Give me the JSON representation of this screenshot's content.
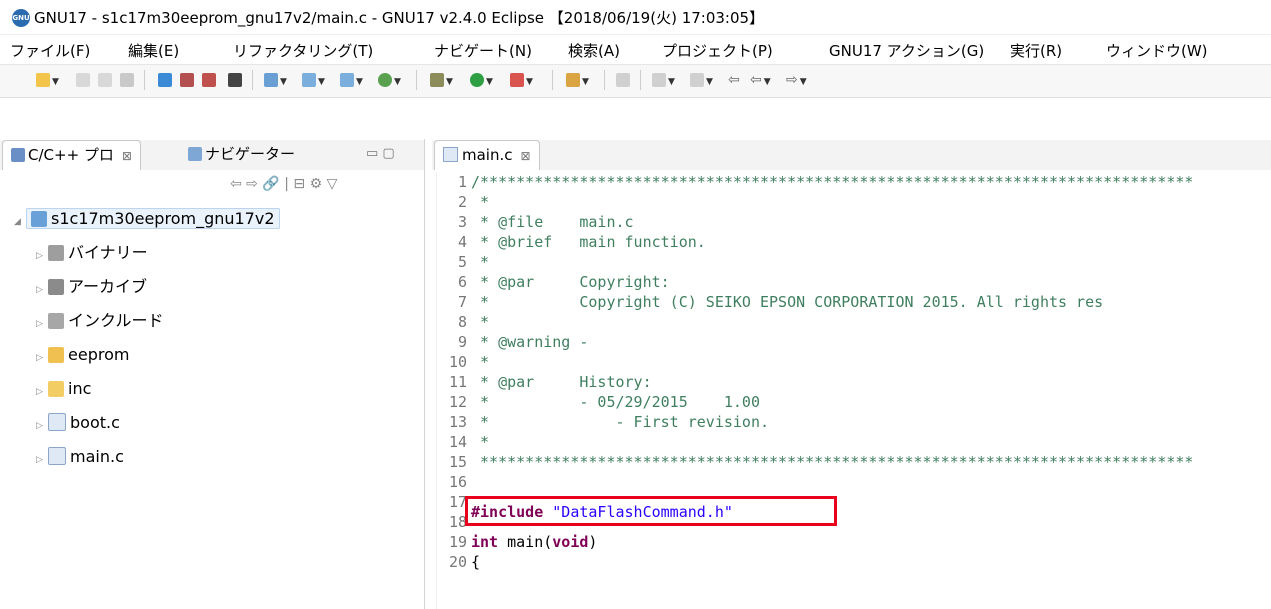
{
  "window": {
    "title": "GNU17 - s1c17m30eeprom_gnu17v2/main.c - GNU17 v2.4.0 Eclipse  【2018/06/19(火) 17:03:05】",
    "app_icon": "GNU"
  },
  "menu": [
    "ファイル(F)",
    "編集(E)",
    "リファクタリング(T)",
    "ナビゲート(N)",
    "検索(A)",
    "プロジェクト(P)",
    "GNU17 アクション(G)",
    "実行(R)",
    "ウィンドウ(W)"
  ],
  "left_panel": {
    "tab1": "C/C++ プロ",
    "tab2": "ナビゲーター",
    "close": "⊠",
    "minmax": "▭ ▢",
    "view_tools": "⇦ ⇨ 🔗 | ⊟ ⚙ ▽",
    "tree": {
      "root": "s1c17m30eeprom_gnu17v2",
      "items": [
        "バイナリー",
        "アーカイブ",
        "インクルード",
        "eeprom",
        "inc",
        "boot.c",
        "main.c"
      ]
    }
  },
  "editor": {
    "tab_label": "main.c",
    "tab_close": "⊠",
    "lines": [
      {
        "n": "1",
        "text": "/*******************************************************************************"
      },
      {
        "n": "2",
        "text": " *"
      },
      {
        "n": "3",
        "text": " * @file    main.c"
      },
      {
        "n": "4",
        "text": " * @brief   main function."
      },
      {
        "n": "5",
        "text": " *"
      },
      {
        "n": "6",
        "text": " * @par     Copyright:"
      },
      {
        "n": "7",
        "text": " *          Copyright (C) SEIKO EPSON CORPORATION 2015. All rights res"
      },
      {
        "n": "8",
        "text": " *"
      },
      {
        "n": "9",
        "text": " * @warning -"
      },
      {
        "n": "10",
        "text": " *"
      },
      {
        "n": "11",
        "text": " * @par     History:"
      },
      {
        "n": "12",
        "text": " *          - 05/29/2015    1.00"
      },
      {
        "n": "13",
        "text": " *              - First revision."
      },
      {
        "n": "14",
        "text": " *"
      },
      {
        "n": "15",
        "text": " *******************************************************************************"
      },
      {
        "n": "16",
        "text": ""
      },
      {
        "n": "17",
        "text": ""
      },
      {
        "n": "18",
        "text": ""
      },
      {
        "n": "19",
        "text": ""
      },
      {
        "n": "20",
        "text": "{"
      }
    ],
    "include_kw": "#include",
    "include_str": "\"DataFlashCommand.h\"",
    "main_kw": "int",
    "main_name": " main(",
    "main_kw2": "void",
    "main_end": ")"
  },
  "colors": {
    "highlight_box": "#e8001c",
    "comment": "#3f7f5f",
    "keyword": "#7f0055",
    "string": "#2a00ff"
  }
}
